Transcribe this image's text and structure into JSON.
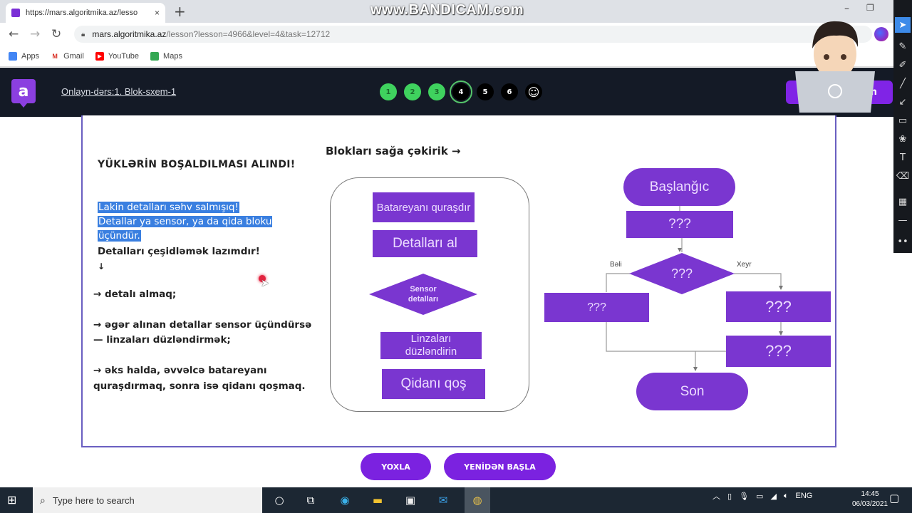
{
  "browser": {
    "tab_title": "https://mars.algoritmika.az/lesso",
    "tab_close": "×",
    "new_tab": "+",
    "url_host": "mars.algoritmika.az",
    "url_path": "/lesson?lesson=4966&level=4&task=12712",
    "back": "←",
    "forward": "→",
    "reload": "↻",
    "minimize": "–",
    "maximize": "❐",
    "bookmarks": [
      {
        "label": "Apps",
        "icon": "apps-grid-icon",
        "color": "#4285f4",
        "glyph": "⋮"
      },
      {
        "label": "Gmail",
        "icon": "gmail-icon",
        "color": "#d93025",
        "glyph": "M"
      },
      {
        "label": "YouTube",
        "icon": "youtube-icon",
        "color": "#ff0000",
        "glyph": "▶"
      },
      {
        "label": "Maps",
        "icon": "maps-icon",
        "color": "#34a853",
        "glyph": "◆"
      }
    ]
  },
  "watermark": "www.BANDICAM.com",
  "app": {
    "logo_letter": "a",
    "lesson_title": "Onlayn-dərs:1. Blok-sxem-1",
    "steps": [
      {
        "label": "1",
        "state": "done"
      },
      {
        "label": "2",
        "state": "done"
      },
      {
        "label": "3",
        "state": "done"
      },
      {
        "label": "4",
        "state": "current"
      },
      {
        "label": "5",
        "state": "todo"
      },
      {
        "label": "6",
        "state": "todo"
      },
      {
        "label": "☺",
        "state": "final"
      }
    ],
    "header_button_label": "n",
    "accent": "#7b22e0"
  },
  "task": {
    "title": "YÜKLƏRİN BOŞALDILMASI ALINDI!",
    "highlighted_lines": [
      "Lakin detalları səhv salmışıq!",
      "Detallar ya sensor, ya da qida bloku",
      "üçündür."
    ],
    "line_sort": "Detalları çeşidləmək lazımdır!",
    "down_arrow": "↓",
    "step1": "→ detalı almaq;",
    "step2_a": "→ əgər alınan detallar sensor üçündürsə",
    "step2_b": "— linzaları düzləndirmək;",
    "step3_a": "→ əks halda, əvvəlcə batareyanı",
    "step3_b": "quraşdırmaq, sonra isə qidanı qoşmaq."
  },
  "palette": {
    "title": "Blokları sağa çəkirik →",
    "blocks": [
      {
        "label": "Batareyanı quraşdır",
        "shape": "rect"
      },
      {
        "label": "Detalları al",
        "shape": "rect"
      },
      {
        "label": "Sensor detalları",
        "shape": "diamond"
      },
      {
        "label": "Linzaları düzləndirin",
        "shape": "rect"
      },
      {
        "label": "Qidanı qoş",
        "shape": "rect"
      }
    ]
  },
  "flowchart": {
    "start": "Başlanğıc",
    "step_a": "???",
    "decision": "???",
    "yes_label": "Bəli",
    "no_label": "Xeyr",
    "yes_branch": "???",
    "no_branch_1": "???",
    "no_branch_2": "???",
    "end": "Son"
  },
  "buttons": {
    "check": "YOXLA",
    "restart": "YENİDƏN BAŞLA"
  },
  "taskbar": {
    "search_placeholder": "Type here to search",
    "language": "ENG",
    "time": "14:45",
    "date": "06/03/2021"
  }
}
